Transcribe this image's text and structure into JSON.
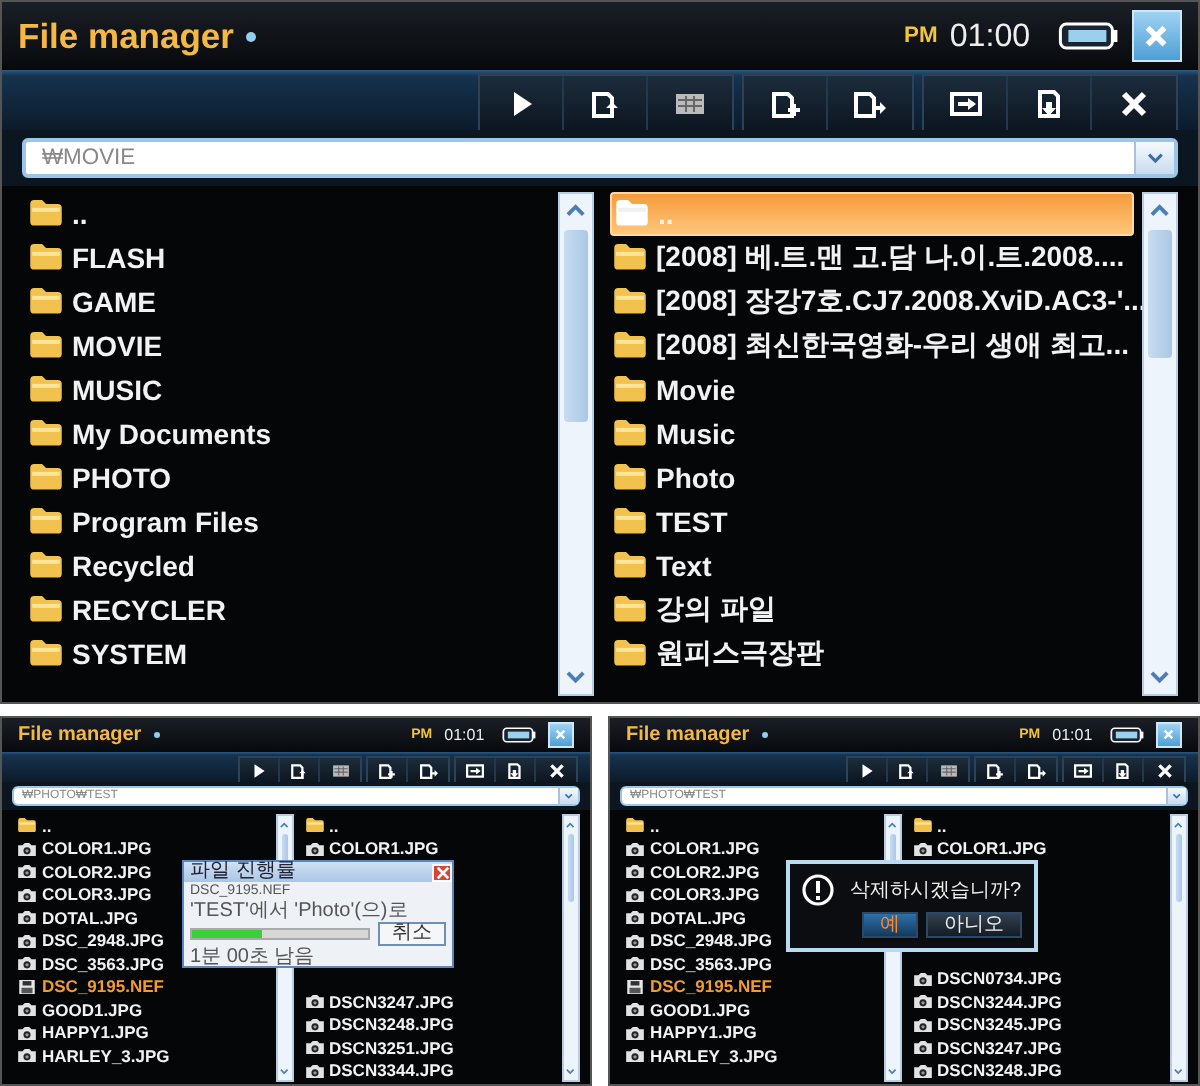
{
  "screens": [
    {
      "title": "File manager",
      "ampm": "PM",
      "time": "01:00",
      "path": "₩MOVIE",
      "left_pane": {
        "items": [
          {
            "kind": "folder",
            "name": "..",
            "selected": false,
            "marked": false
          },
          {
            "kind": "folder",
            "name": "FLASH",
            "selected": false,
            "marked": false
          },
          {
            "kind": "folder",
            "name": "GAME",
            "selected": false,
            "marked": false
          },
          {
            "kind": "folder",
            "name": "MOVIE",
            "selected": false,
            "marked": false
          },
          {
            "kind": "folder",
            "name": "MUSIC",
            "selected": false,
            "marked": false
          },
          {
            "kind": "folder",
            "name": "My Documents",
            "selected": false,
            "marked": false
          },
          {
            "kind": "folder",
            "name": "PHOTO",
            "selected": false,
            "marked": false
          },
          {
            "kind": "folder",
            "name": "Program Files",
            "selected": false,
            "marked": false
          },
          {
            "kind": "folder",
            "name": "Recycled",
            "selected": false,
            "marked": false
          },
          {
            "kind": "folder",
            "name": "RECYCLER",
            "selected": false,
            "marked": false
          },
          {
            "kind": "folder",
            "name": "SYSTEM",
            "selected": false,
            "marked": false
          }
        ]
      },
      "right_pane": {
        "items": [
          {
            "kind": "folder",
            "name": "..",
            "selected": true,
            "marked": false
          },
          {
            "kind": "folder",
            "name": "[2008] 베.트.맨 고.담 나.이.트.2008....",
            "selected": false,
            "marked": false
          },
          {
            "kind": "folder",
            "name": "[2008] 장강7호.CJ7.2008.XviD.AC3-'...",
            "selected": false,
            "marked": false
          },
          {
            "kind": "folder",
            "name": "[2008] 최신한국영화-우리 생애 최고...",
            "selected": false,
            "marked": false
          },
          {
            "kind": "folder",
            "name": "Movie",
            "selected": false,
            "marked": false
          },
          {
            "kind": "folder",
            "name": "Music",
            "selected": false,
            "marked": false
          },
          {
            "kind": "folder",
            "name": "Photo",
            "selected": false,
            "marked": false
          },
          {
            "kind": "folder",
            "name": "TEST",
            "selected": false,
            "marked": false
          },
          {
            "kind": "folder",
            "name": "Text",
            "selected": false,
            "marked": false
          },
          {
            "kind": "folder",
            "name": "강의 파일",
            "selected": false,
            "marked": false
          },
          {
            "kind": "folder",
            "name": "원피스극장판",
            "selected": false,
            "marked": false
          }
        ]
      }
    },
    {
      "title": "File manager",
      "ampm": "PM",
      "time": "01:01",
      "path": "₩PHOTO₩TEST",
      "left_pane": {
        "items": [
          {
            "kind": "folder",
            "name": "..",
            "selected": false,
            "marked": false
          },
          {
            "kind": "image",
            "name": "COLOR1.JPG",
            "selected": false,
            "marked": false
          },
          {
            "kind": "image",
            "name": "COLOR2.JPG",
            "selected": false,
            "marked": false
          },
          {
            "kind": "image",
            "name": "COLOR3.JPG",
            "selected": false,
            "marked": false
          },
          {
            "kind": "image",
            "name": "DOTAL.JPG",
            "selected": false,
            "marked": false
          },
          {
            "kind": "image",
            "name": "DSC_2948.JPG",
            "selected": false,
            "marked": false
          },
          {
            "kind": "image",
            "name": "DSC_3563.JPG",
            "selected": false,
            "marked": false
          },
          {
            "kind": "file",
            "name": "DSC_9195.NEF",
            "selected": false,
            "marked": true
          },
          {
            "kind": "image",
            "name": "GOOD1.JPG",
            "selected": false,
            "marked": false
          },
          {
            "kind": "image",
            "name": "HAPPY1.JPG",
            "selected": false,
            "marked": false
          },
          {
            "kind": "image",
            "name": "HARLEY_3.JPG",
            "selected": false,
            "marked": false
          }
        ]
      },
      "right_pane": {
        "items": [
          {
            "kind": "folder",
            "name": "..",
            "selected": false,
            "marked": false
          },
          {
            "kind": "image",
            "name": "COLOR1.JPG",
            "selected": false,
            "marked": false
          }
        ],
        "items_below": [
          {
            "kind": "image",
            "name": "DSCN3247.JPG",
            "selected": false,
            "marked": false
          },
          {
            "kind": "image",
            "name": "DSCN3248.JPG",
            "selected": false,
            "marked": false
          },
          {
            "kind": "image",
            "name": "DSCN3251.JPG",
            "selected": false,
            "marked": false
          },
          {
            "kind": "image",
            "name": "DSCN3344.JPG",
            "selected": false,
            "marked": false
          }
        ]
      },
      "dialog": {
        "kind": "progress",
        "title": "파일 진행률",
        "file": "DSC_9195.NEF",
        "message": "'TEST'에서 'Photo'(으)로",
        "level": 0.4,
        "button": "취소",
        "remaining": "1분 00초 남음"
      }
    },
    {
      "title": "File manager",
      "ampm": "PM",
      "time": "01:01",
      "path": "₩PHOTO₩TEST",
      "left_pane": {
        "items": [
          {
            "kind": "folder",
            "name": "..",
            "selected": false,
            "marked": false
          },
          {
            "kind": "image",
            "name": "COLOR1.JPG",
            "selected": false,
            "marked": false
          },
          {
            "kind": "image",
            "name": "COLOR2.JPG",
            "selected": false,
            "marked": false
          },
          {
            "kind": "image",
            "name": "COLOR3.JPG",
            "selected": false,
            "marked": false
          },
          {
            "kind": "image",
            "name": "DOTAL.JPG",
            "selected": false,
            "marked": false
          },
          {
            "kind": "image",
            "name": "DSC_2948.JPG",
            "selected": false,
            "marked": false
          },
          {
            "kind": "image",
            "name": "DSC_3563.JPG",
            "selected": false,
            "marked": false
          },
          {
            "kind": "file",
            "name": "DSC_9195.NEF",
            "selected": false,
            "marked": true
          },
          {
            "kind": "image",
            "name": "GOOD1.JPG",
            "selected": false,
            "marked": false
          },
          {
            "kind": "image",
            "name": "HAPPY1.JPG",
            "selected": false,
            "marked": false
          },
          {
            "kind": "image",
            "name": "HARLEY_3.JPG",
            "selected": false,
            "marked": false
          }
        ]
      },
      "right_pane": {
        "items": [
          {
            "kind": "folder",
            "name": "..",
            "selected": false,
            "marked": false
          },
          {
            "kind": "image",
            "name": "COLOR1.JPG",
            "selected": false,
            "marked": false
          }
        ],
        "items_below": [
          {
            "kind": "image",
            "name": "DSCN0734.JPG",
            "selected": false,
            "marked": false
          },
          {
            "kind": "image",
            "name": "DSCN3244.JPG",
            "selected": false,
            "marked": false
          },
          {
            "kind": "image",
            "name": "DSCN3245.JPG",
            "selected": false,
            "marked": false
          },
          {
            "kind": "image",
            "name": "DSCN3247.JPG",
            "selected": false,
            "marked": false
          },
          {
            "kind": "image",
            "name": "DSCN3248.JPG",
            "selected": false,
            "marked": false
          }
        ]
      },
      "dialog": {
        "kind": "confirm",
        "message": "삭제하시겠습니까?",
        "buttons": [
          {
            "label": "예",
            "selected": true
          },
          {
            "label": "아니오",
            "selected": false
          }
        ]
      }
    }
  ]
}
